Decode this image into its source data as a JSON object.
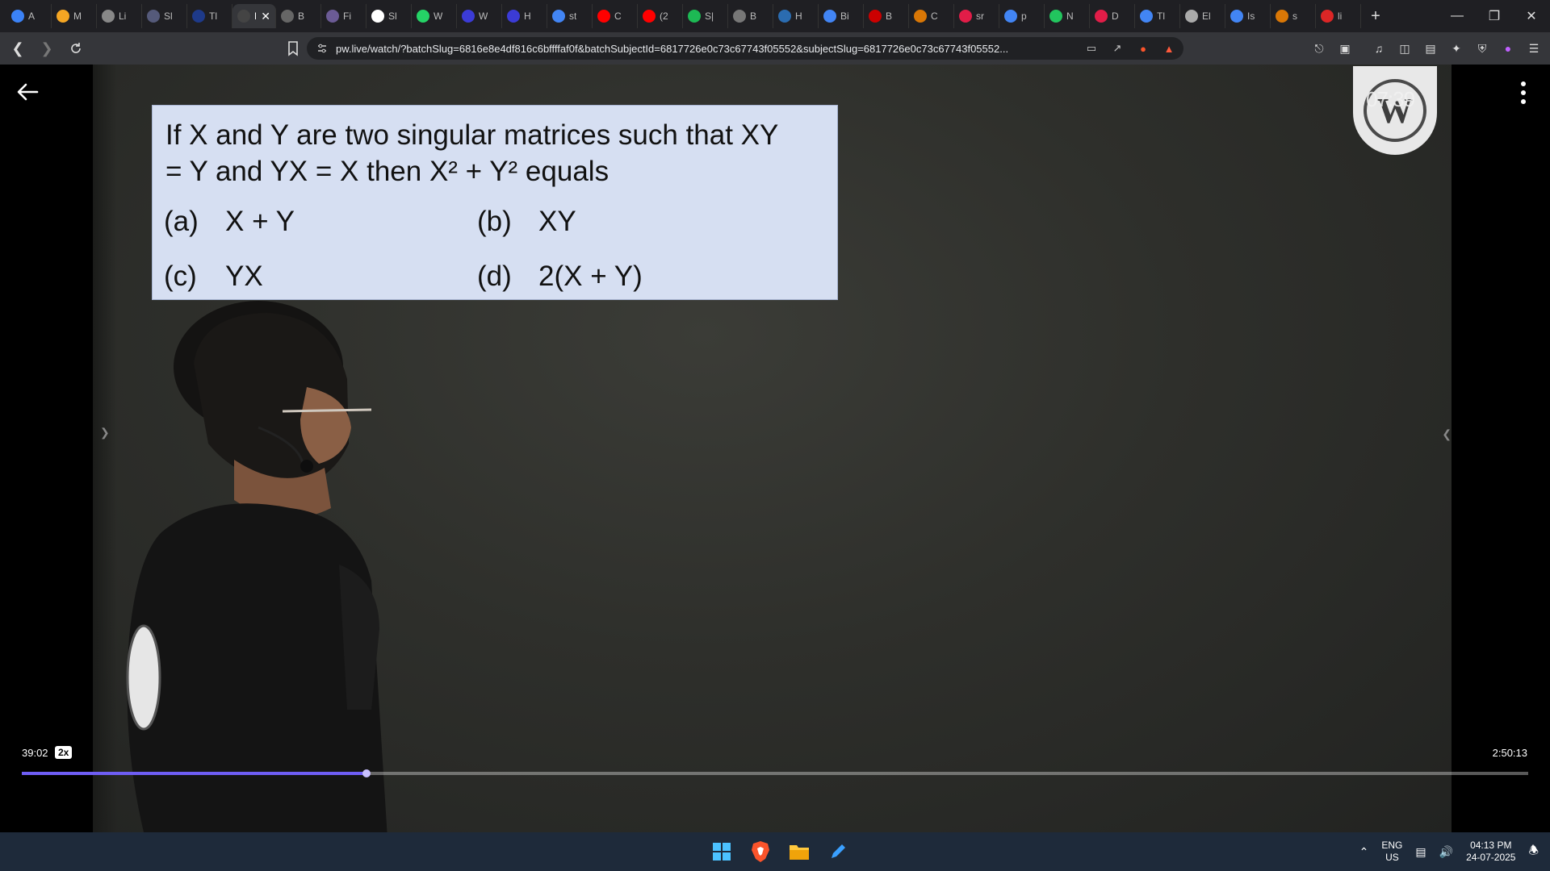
{
  "browser": {
    "tabs": [
      {
        "title": "A",
        "color": "#3b82f6"
      },
      {
        "title": "M",
        "color": "#f5a623"
      },
      {
        "title": "Li",
        "color": "#888888"
      },
      {
        "title": "Sl",
        "color": "#555a7a"
      },
      {
        "title": "Tl",
        "color": "#1e3a8a"
      },
      {
        "title": "P",
        "color": "#444444",
        "active": true
      },
      {
        "title": "B",
        "color": "#666666"
      },
      {
        "title": "Fi",
        "color": "#6b5b95"
      },
      {
        "title": "Sl",
        "color": "#ffffff"
      },
      {
        "title": "W",
        "color": "#25d366"
      },
      {
        "title": "W",
        "color": "#3b3bd6"
      },
      {
        "title": "H",
        "color": "#3b3bd6"
      },
      {
        "title": "st",
        "color": "#4285f4"
      },
      {
        "title": "C",
        "color": "#ff0000"
      },
      {
        "title": "(2",
        "color": "#ff0000"
      },
      {
        "title": "S|",
        "color": "#1db954"
      },
      {
        "title": "B",
        "color": "#777777"
      },
      {
        "title": "H",
        "color": "#2b6cb0"
      },
      {
        "title": "Bi",
        "color": "#4285f4"
      },
      {
        "title": "B",
        "color": "#cc0000"
      },
      {
        "title": "C",
        "color": "#d97706"
      },
      {
        "title": "sr",
        "color": "#e11d48"
      },
      {
        "title": "p",
        "color": "#4285f4"
      },
      {
        "title": "N",
        "color": "#22c55e"
      },
      {
        "title": "D",
        "color": "#e11d48"
      },
      {
        "title": "Tl",
        "color": "#4285f4"
      },
      {
        "title": "El",
        "color": "#aaaaaa"
      },
      {
        "title": "Is",
        "color": "#4285f4"
      },
      {
        "title": "s",
        "color": "#d97706"
      },
      {
        "title": "li",
        "color": "#dc2626"
      }
    ],
    "url": "pw.live/watch/?batchSlug=6816e8e4df816c6bffffaf0f&batchSubjectId=6817726e0c73c67743f05552&subjectSlug=6817726e0c73c67743f05552..."
  },
  "question": {
    "line1": "If X and Y are two singular matrices such that XY",
    "line2": "= Y and YX = X then X² + Y² equals",
    "options": [
      {
        "label": "(a)",
        "text": "X + Y"
      },
      {
        "label": "(b)",
        "text": "XY"
      },
      {
        "label": "(c)",
        "text": "YX"
      },
      {
        "label": "(d)",
        "text": "2(X + Y)"
      }
    ]
  },
  "player": {
    "current_time": "39:02",
    "speed": "2x",
    "duration": "2:50:13",
    "progress_fraction": 0.229,
    "logo_time": "07:39"
  },
  "taskbar": {
    "lang_line1": "ENG",
    "lang_line2": "US",
    "time": "04:13 PM",
    "date": "24-07-2025"
  }
}
